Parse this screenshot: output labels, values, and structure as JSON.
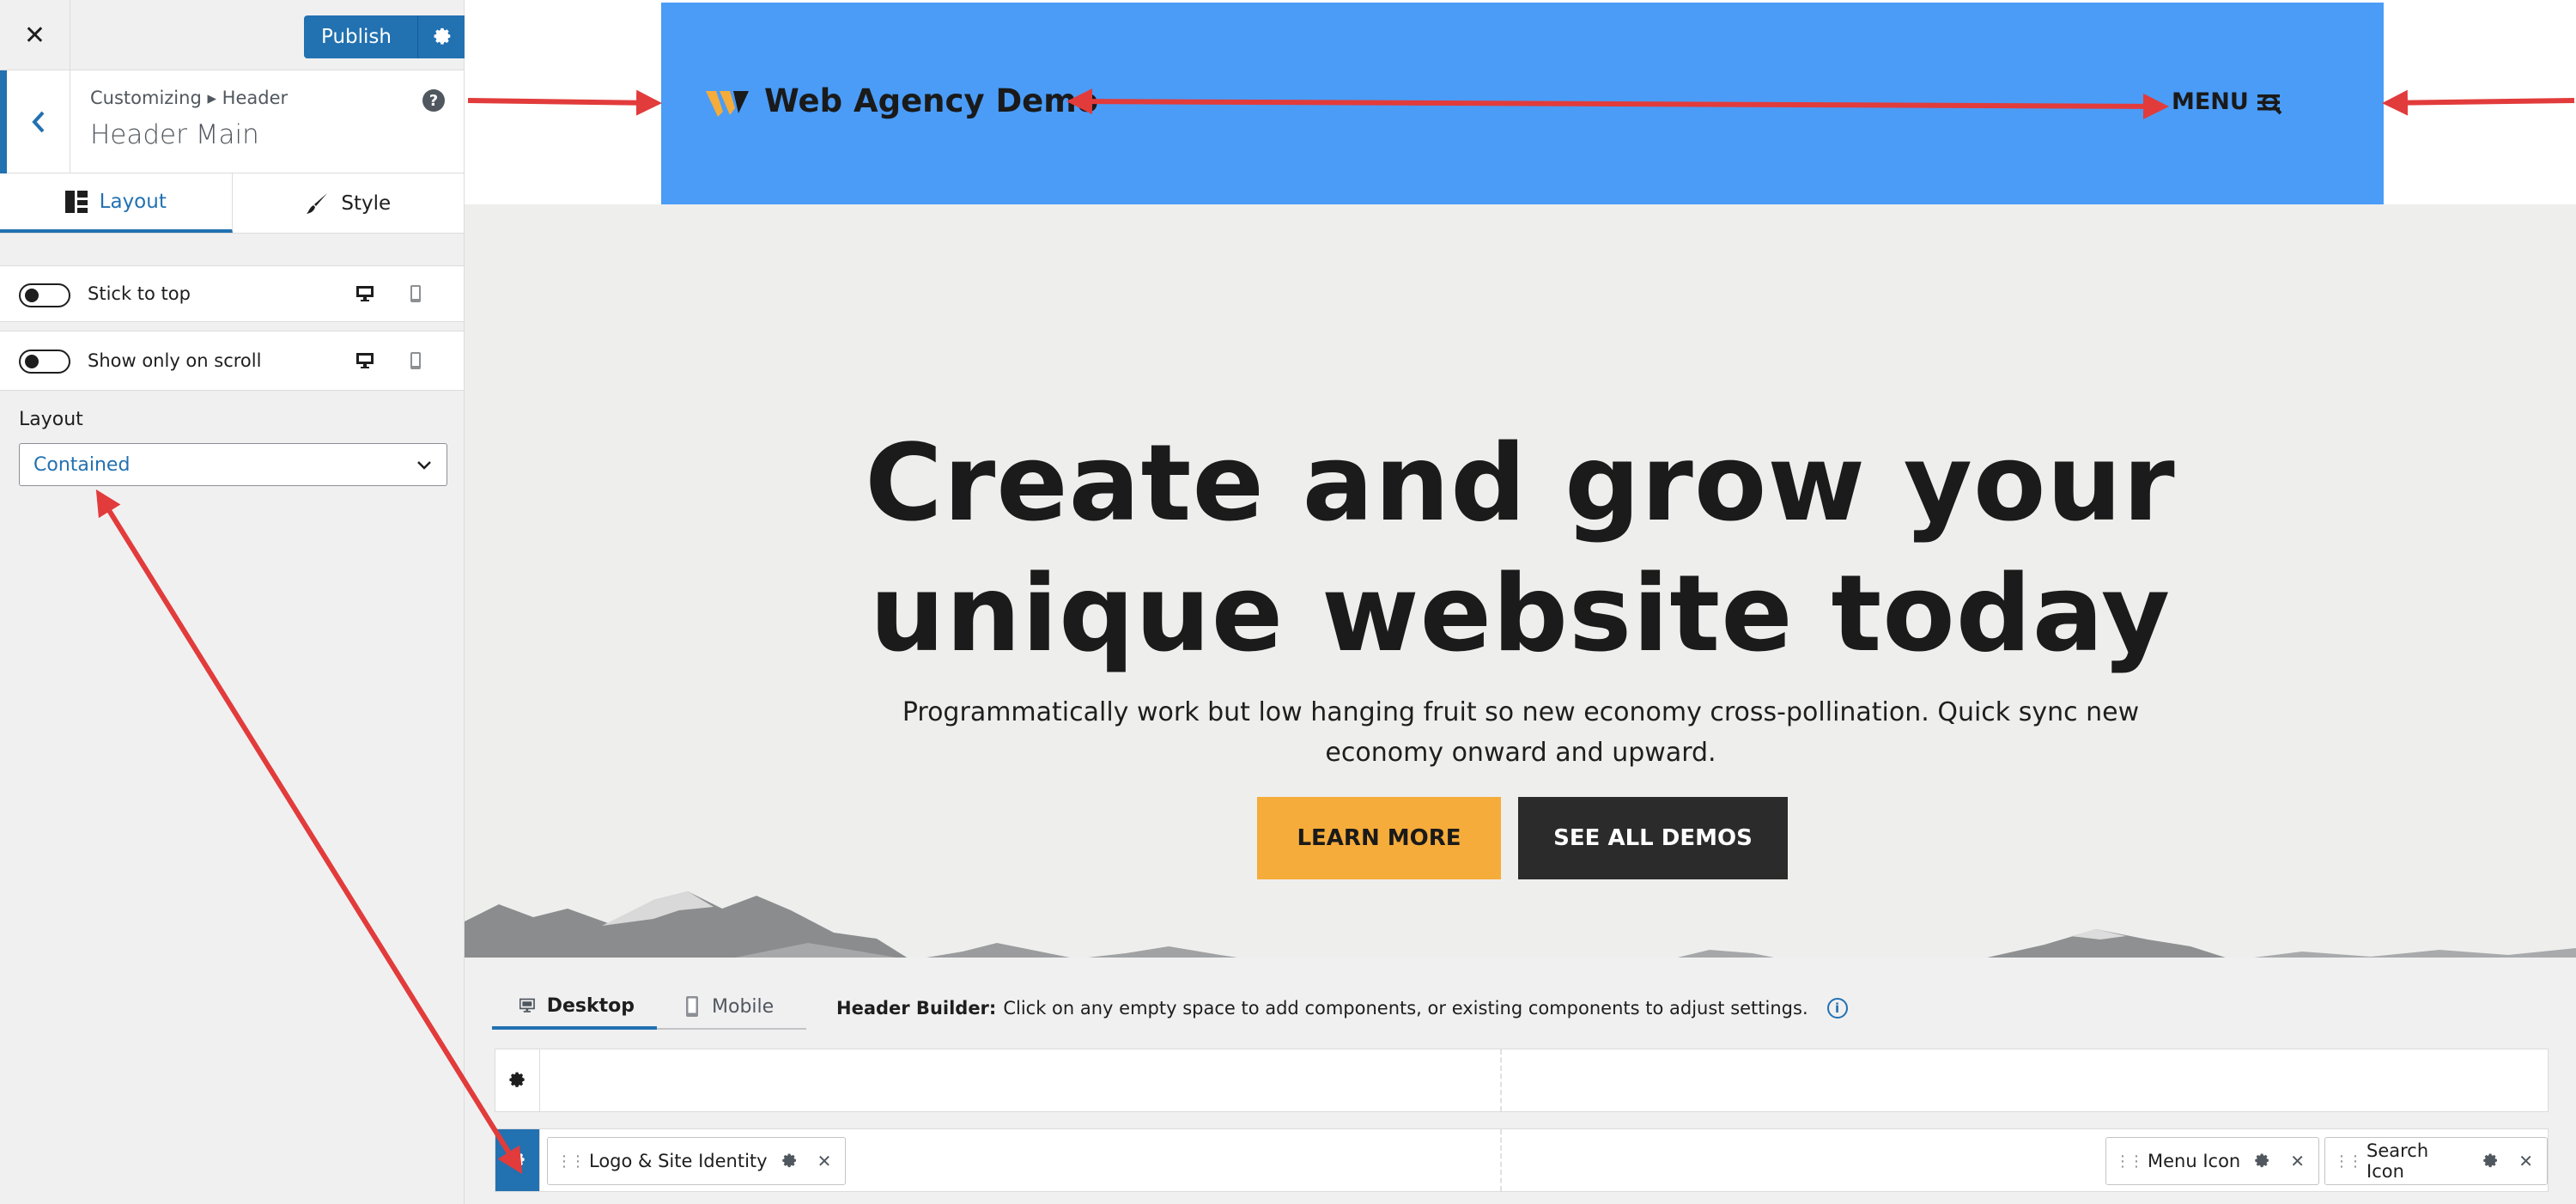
{
  "topbar": {
    "close_symbol": "✕",
    "publish_label": "Publish"
  },
  "panel": {
    "breadcrumb": "Customizing ▸ Header",
    "title": "Header Main",
    "help_symbol": "?",
    "tabs": [
      {
        "label": "Layout",
        "icon": "layout-grid-icon"
      },
      {
        "label": "Style",
        "icon": "paintbrush-icon"
      }
    ],
    "toggles": [
      {
        "label": "Stick to top",
        "on": false
      },
      {
        "label": "Show only on scroll",
        "on": false
      }
    ],
    "layout_label": "Layout",
    "layout_value": "Contained"
  },
  "site": {
    "title": "Web Agency Demo",
    "menu_label": "MENU",
    "header_bg": "#4a9cf7",
    "hero_line1": "Create and grow your",
    "hero_line2": "unique website today",
    "hero_text_line1": "Programmatically work but low hanging fruit so new economy cross-pollination. Quick sync new",
    "hero_text_line2": "economy onward and upward.",
    "btn_learn": "LEARN MORE",
    "btn_demos": "SEE ALL DEMOS",
    "accent_orange": "#f6ac3a"
  },
  "builder": {
    "tabs": [
      {
        "label": "Desktop",
        "icon": "monitor-icon"
      },
      {
        "label": "Mobile",
        "icon": "phone-icon"
      }
    ],
    "info_bold": "Header Builder:",
    "info_text": "Click on any empty space to add components, or existing components to adjust settings.",
    "info_symbol": "i",
    "components": {
      "logo": "Logo & Site Identity",
      "menu": "Menu Icon",
      "search": "Search Icon"
    },
    "remove_symbol": "✕",
    "accent": "#2271b1"
  },
  "annotation_color": "#e23b3b"
}
